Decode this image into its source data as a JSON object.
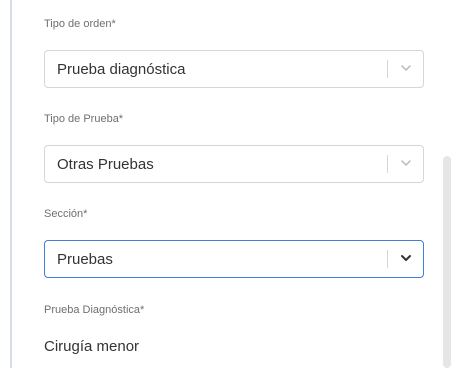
{
  "form": {
    "fields": [
      {
        "label": "Tipo de orden*",
        "value": "Prueba diagnóstica",
        "state": "normal"
      },
      {
        "label": "Tipo de Prueba*",
        "value": "Otras Pruebas",
        "state": "normal"
      },
      {
        "label": "Sección*",
        "value": "Pruebas",
        "state": "focused"
      }
    ],
    "readonly": {
      "label": "Prueba Diagnóstica*",
      "value": "Cirugía menor"
    }
  },
  "colors": {
    "label": "#6f6f6f",
    "value": "#333333",
    "border": "#d6d6d6",
    "focus_border": "#3f7fd6",
    "chevron_muted": "#b8b8b8",
    "chevron_active": "#333333",
    "left_rule": "#d7dde6",
    "scroll_thumb": "#e6e6e6"
  },
  "icons": {
    "dropdown": "chevron-down-icon"
  }
}
